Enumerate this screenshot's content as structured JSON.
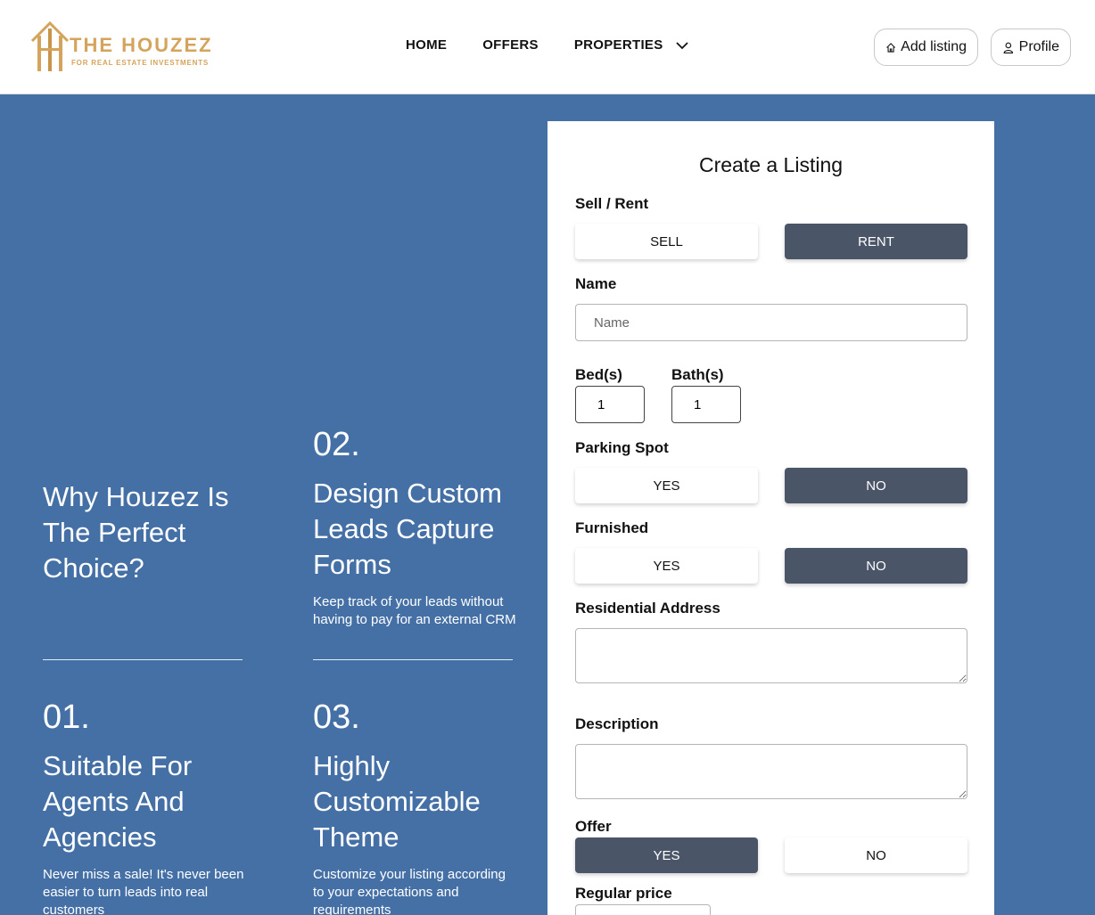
{
  "brand": {
    "title": "THE HOUZEZ",
    "subtitle": "FOR REAL ESTATE INVESTMENTS",
    "color": "#d4a45c"
  },
  "nav": {
    "home": "HOME",
    "offers": "OFFERS",
    "properties": "PROPERTIES"
  },
  "header_buttons": {
    "add_listing": "Add listing",
    "profile": "Profile"
  },
  "features": {
    "intro": "Why Houzez Is The Perfect Choice?",
    "items": [
      {
        "num": "01.",
        "title": "Suitable For Agents And Agencies",
        "desc": "Never miss a sale! It's never been easier to turn leads into real customers"
      },
      {
        "num": "02.",
        "title": "Design Custom Leads Capture Forms",
        "desc": "Keep track of your leads without having to pay for an external CRM"
      },
      {
        "num": "03.",
        "title": "Highly Customizable Theme",
        "desc": "Customize your listing according to your expectations and requirements"
      }
    ]
  },
  "form": {
    "title": "Create a Listing",
    "sell_rent": {
      "label": "Sell / Rent",
      "options": [
        "SELL",
        "RENT"
      ],
      "selected": "RENT"
    },
    "name": {
      "label": "Name",
      "placeholder": "Name",
      "value": ""
    },
    "beds": {
      "label": "Bed(s)",
      "value": "1"
    },
    "baths": {
      "label": "Bath(s)",
      "value": "1"
    },
    "parking": {
      "label": "Parking Spot",
      "options": [
        "YES",
        "NO"
      ],
      "selected": "NO"
    },
    "furnished": {
      "label": "Furnished",
      "options": [
        "YES",
        "NO"
      ],
      "selected": "NO"
    },
    "address": {
      "label": "Residential Address",
      "value": ""
    },
    "description": {
      "label": "Description",
      "value": ""
    },
    "offer": {
      "label": "Offer",
      "options": [
        "YES",
        "NO"
      ],
      "selected": "YES"
    },
    "regular_price": {
      "label": "Regular price"
    }
  },
  "colors": {
    "background": "#4570a5",
    "toggle_active": "#4a5568",
    "card": "#ffffff"
  },
  "icons": [
    "house-icon",
    "person-icon",
    "chevron-down-icon",
    "logo-mark-icon"
  ]
}
